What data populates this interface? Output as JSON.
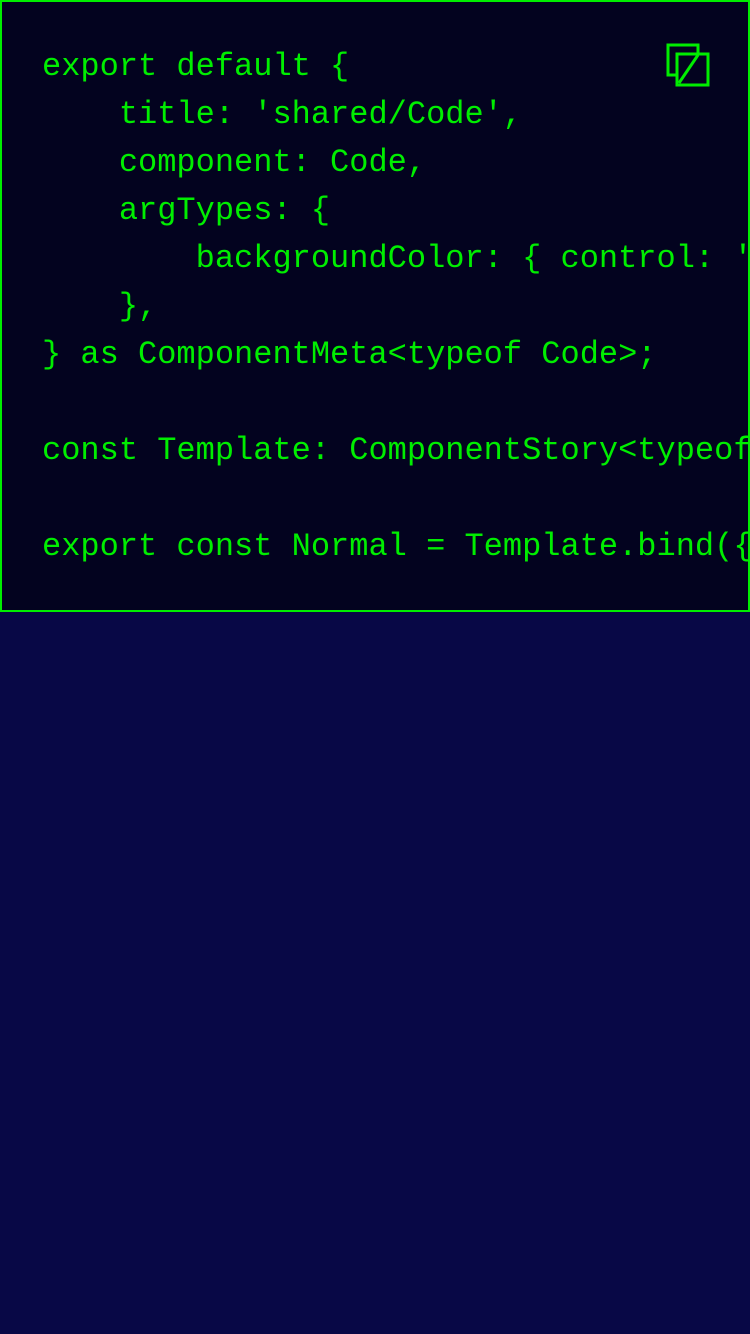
{
  "code_block": {
    "lines": [
      "export default {",
      "    title: 'shared/Code',",
      "    component: Code,",
      "    argTypes: {",
      "        backgroundColor: { control: '",
      "    },",
      "} as ComponentMeta<typeof Code>;",
      "",
      "const Template: ComponentStory<typeof",
      "",
      "export const Normal = Template.bind({"
    ],
    "copy_icon": "copy-icon"
  },
  "colors": {
    "code_text": "#00ee00",
    "code_border": "#00ee00",
    "code_background": "#03031f",
    "page_background": "#080846"
  }
}
